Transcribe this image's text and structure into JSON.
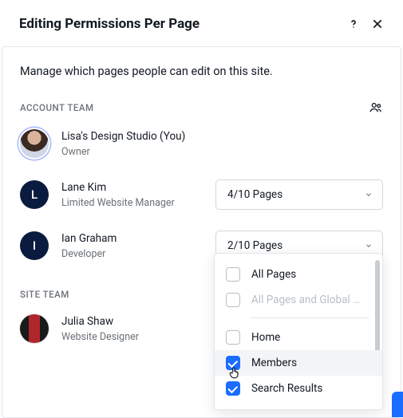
{
  "header": {
    "title": "Editing Permissions Per Page"
  },
  "description": "Manage which pages people can edit on this site.",
  "sections": {
    "account_team": "ACCOUNT TEAM",
    "site_team": "SITE TEAM"
  },
  "members": {
    "lisa": {
      "name": "Lisa's Design Studio (You)",
      "role": "Owner"
    },
    "lane": {
      "name": "Lane Kim",
      "role": "Limited Website Manager",
      "initial": "L",
      "pages": "4/10 Pages"
    },
    "ian": {
      "name": "Ian Graham",
      "role": "Developer",
      "initial": "I",
      "pages": "2/10 Pages"
    },
    "julia": {
      "name": "Julia Shaw",
      "role": "Website Designer"
    }
  },
  "dropdown": {
    "all_pages": "All Pages",
    "all_global": "All Pages and Global Se…",
    "home": "Home",
    "members": "Members",
    "search_results": "Search Results"
  }
}
